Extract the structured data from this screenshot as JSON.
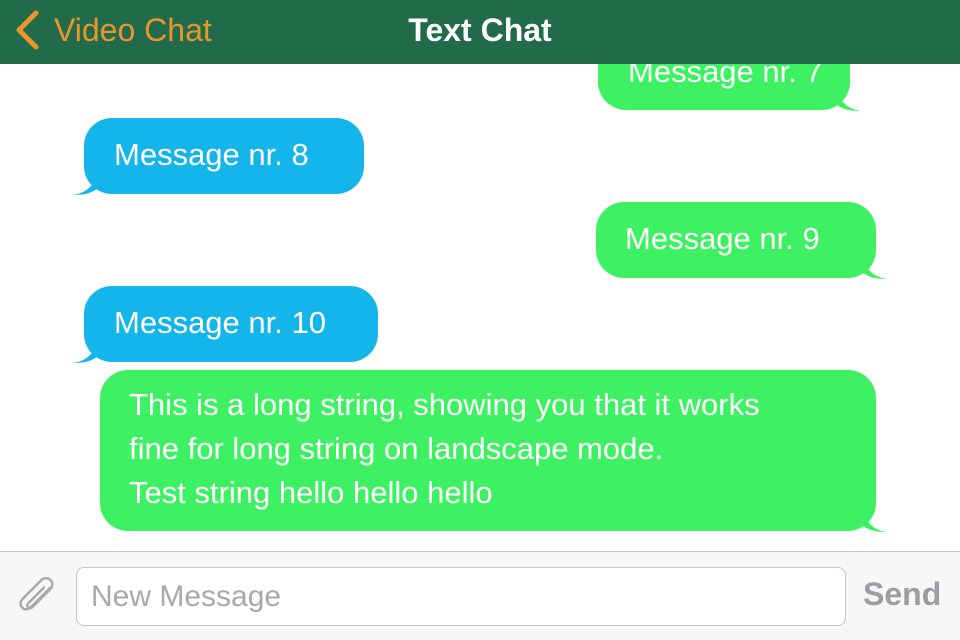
{
  "nav": {
    "back_label": "Video Chat",
    "title": "Text Chat",
    "bar_color": "#226b4a",
    "back_color": "#e8962b"
  },
  "messages": [
    {
      "direction": "outgoing",
      "text": "Message nr. 7"
    },
    {
      "direction": "incoming",
      "text": "Message nr. 8"
    },
    {
      "direction": "outgoing",
      "text": "Message nr. 9"
    },
    {
      "direction": "incoming",
      "text": "Message nr. 10"
    },
    {
      "direction": "outgoing",
      "lines": [
        "This is a long string, showing you that it works",
        "fine for long string on landscape mode.",
        "Test string hello hello hello"
      ]
    }
  ],
  "colors": {
    "incoming_bubble": "#13b5ea",
    "outgoing_bubble": "#3ef162"
  },
  "composer": {
    "placeholder": "New Message",
    "send_label": "Send",
    "attach_icon": "paperclip-icon"
  }
}
